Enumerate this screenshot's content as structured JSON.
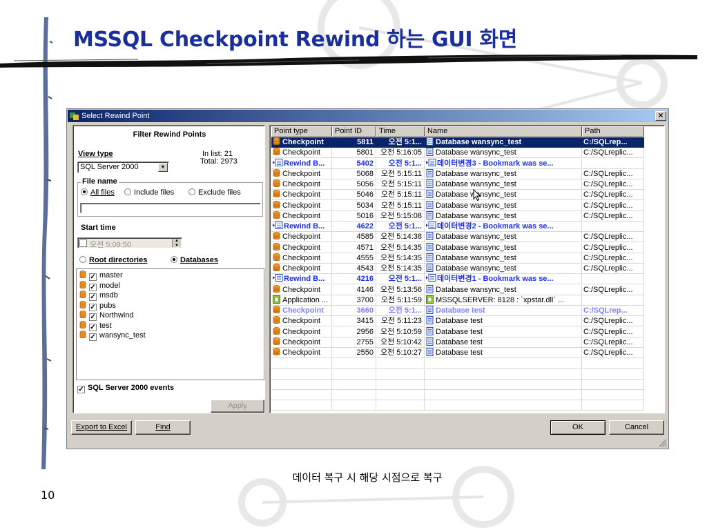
{
  "slide": {
    "title": "MSSQL Checkpoint Rewind 하는 GUI 화면",
    "caption": "데이터 복구 시 해당 시점으로 복구",
    "page_number": "10"
  },
  "window": {
    "title": "Select Rewind Point",
    "close_label": "×"
  },
  "filter": {
    "title": "Filter Rewind Points",
    "view_type_label": "View type",
    "view_type_value": "SQL Server 2000",
    "in_list": "In list: 21",
    "total": "Total: 2973",
    "file_name_label": "File name",
    "radio_all_files": "All files",
    "radio_include_files": "Include files",
    "radio_exclude_files": "Exclude files",
    "start_time_label": "Start time",
    "start_time_value": "오전  5:09:50",
    "radio_root_dirs": "Root directories",
    "radio_databases": "Databases",
    "databases": [
      "master",
      "model",
      "msdb",
      "pubs",
      "Northwind",
      "test",
      "wansync_test"
    ],
    "sql_events_label": "SQL Server 2000 events",
    "apply_label": "Apply"
  },
  "grid": {
    "columns": [
      "Point type",
      "Point ID",
      "Time",
      "Name",
      "Path"
    ],
    "rows": [
      {
        "style": "sel",
        "icon": "database-icon",
        "type": "Checkpoint",
        "id": "5811",
        "time": "오전 5:1...",
        "name": "Database wansync_test",
        "path": "C:/SQLrep..."
      },
      {
        "style": "",
        "icon": "database-icon",
        "type": "Checkpoint",
        "id": "5801",
        "time": "오전 5:16:05",
        "name": "Database wansync_test",
        "path": "C:/SQLreplic..."
      },
      {
        "style": "bm",
        "icon": "bookmark-icon",
        "type": "Rewind B...",
        "id": "5402",
        "time": "오전 5:1...",
        "name": "데이터변경3 - Bookmark was se...",
        "path": ""
      },
      {
        "style": "",
        "icon": "database-icon",
        "type": "Checkpoint",
        "id": "5068",
        "time": "오전 5:15:11",
        "name": "Database wansync_test",
        "path": "C:/SQLreplic..."
      },
      {
        "style": "",
        "icon": "database-icon",
        "type": "Checkpoint",
        "id": "5056",
        "time": "오전 5:15:11",
        "name": "Database wansync_test",
        "path": "C:/SQLreplic..."
      },
      {
        "style": "",
        "icon": "database-icon",
        "type": "Checkpoint",
        "id": "5046",
        "time": "오전 5:15:11",
        "name": "Database wansync_test",
        "path": "C:/SQLreplic..."
      },
      {
        "style": "",
        "icon": "database-icon",
        "type": "Checkpoint",
        "id": "5034",
        "time": "오전 5:15:11",
        "name": "Database wansync_test",
        "path": "C:/SQLreplic..."
      },
      {
        "style": "",
        "icon": "database-icon",
        "type": "Checkpoint",
        "id": "5016",
        "time": "오전 5:15:08",
        "name": "Database wansync_test",
        "path": "C:/SQLreplic..."
      },
      {
        "style": "bm",
        "icon": "bookmark-icon",
        "type": "Rewind B...",
        "id": "4622",
        "time": "오전 5:1...",
        "name": "데이터변경2 - Bookmark was se...",
        "path": ""
      },
      {
        "style": "",
        "icon": "database-icon",
        "type": "Checkpoint",
        "id": "4585",
        "time": "오전 5:14:38",
        "name": "Database wansync_test",
        "path": "C:/SQLreplic..."
      },
      {
        "style": "",
        "icon": "database-icon",
        "type": "Checkpoint",
        "id": "4571",
        "time": "오전 5:14:35",
        "name": "Database wansync_test",
        "path": "C:/SQLreplic..."
      },
      {
        "style": "",
        "icon": "database-icon",
        "type": "Checkpoint",
        "id": "4555",
        "time": "오전 5:14:35",
        "name": "Database wansync_test",
        "path": "C:/SQLreplic..."
      },
      {
        "style": "",
        "icon": "database-icon",
        "type": "Checkpoint",
        "id": "4543",
        "time": "오전 5:14:35",
        "name": "Database wansync_test",
        "path": "C:/SQLreplic..."
      },
      {
        "style": "bm",
        "icon": "bookmark-icon",
        "type": "Rewind B...",
        "id": "4216",
        "time": "오전 5:1...",
        "name": "데이터변경1 - Bookmark was se...",
        "path": ""
      },
      {
        "style": "",
        "icon": "database-icon",
        "type": "Checkpoint",
        "id": "4146",
        "time": "오전 5:13:56",
        "name": "Database wansync_test",
        "path": "C:/SQLreplic..."
      },
      {
        "style": "",
        "icon": "application-icon",
        "type": "Application ...",
        "id": "3700",
        "time": "오전 5:11:59",
        "name": "MSSQLSERVER: 8128 :  `xpstar.dll` ...",
        "path": ""
      },
      {
        "style": "faded",
        "icon": "database-icon",
        "type": "Checkpoint",
        "id": "3660",
        "time": "오전 5:1...",
        "name": "Database test",
        "path": "C:/SQLrep..."
      },
      {
        "style": "",
        "icon": "database-icon",
        "type": "Checkpoint",
        "id": "3415",
        "time": "오전 5:11:23",
        "name": "Database test",
        "path": "C:/SQLreplic..."
      },
      {
        "style": "",
        "icon": "database-icon",
        "type": "Checkpoint",
        "id": "2956",
        "time": "오전 5:10:59",
        "name": "Database test",
        "path": "C:/SQLreplic..."
      },
      {
        "style": "",
        "icon": "database-icon",
        "type": "Checkpoint",
        "id": "2755",
        "time": "오전 5:10:42",
        "name": "Database test",
        "path": "C:/SQLreplic..."
      },
      {
        "style": "",
        "icon": "database-icon",
        "type": "Checkpoint",
        "id": "2550",
        "time": "오전 5:10:27",
        "name": "Database test",
        "path": "C:/SQLreplic..."
      }
    ]
  },
  "buttons": {
    "export": "Export to Excel",
    "find": "Find",
    "ok": "OK",
    "cancel": "Cancel"
  },
  "colors": {
    "title_blue": "#1a2f9b",
    "selection": "#0a246a",
    "bookmark_blue": "#1c2ff0",
    "faded_blue": "#8080ff",
    "dialog_face": "#d4d0c8"
  }
}
